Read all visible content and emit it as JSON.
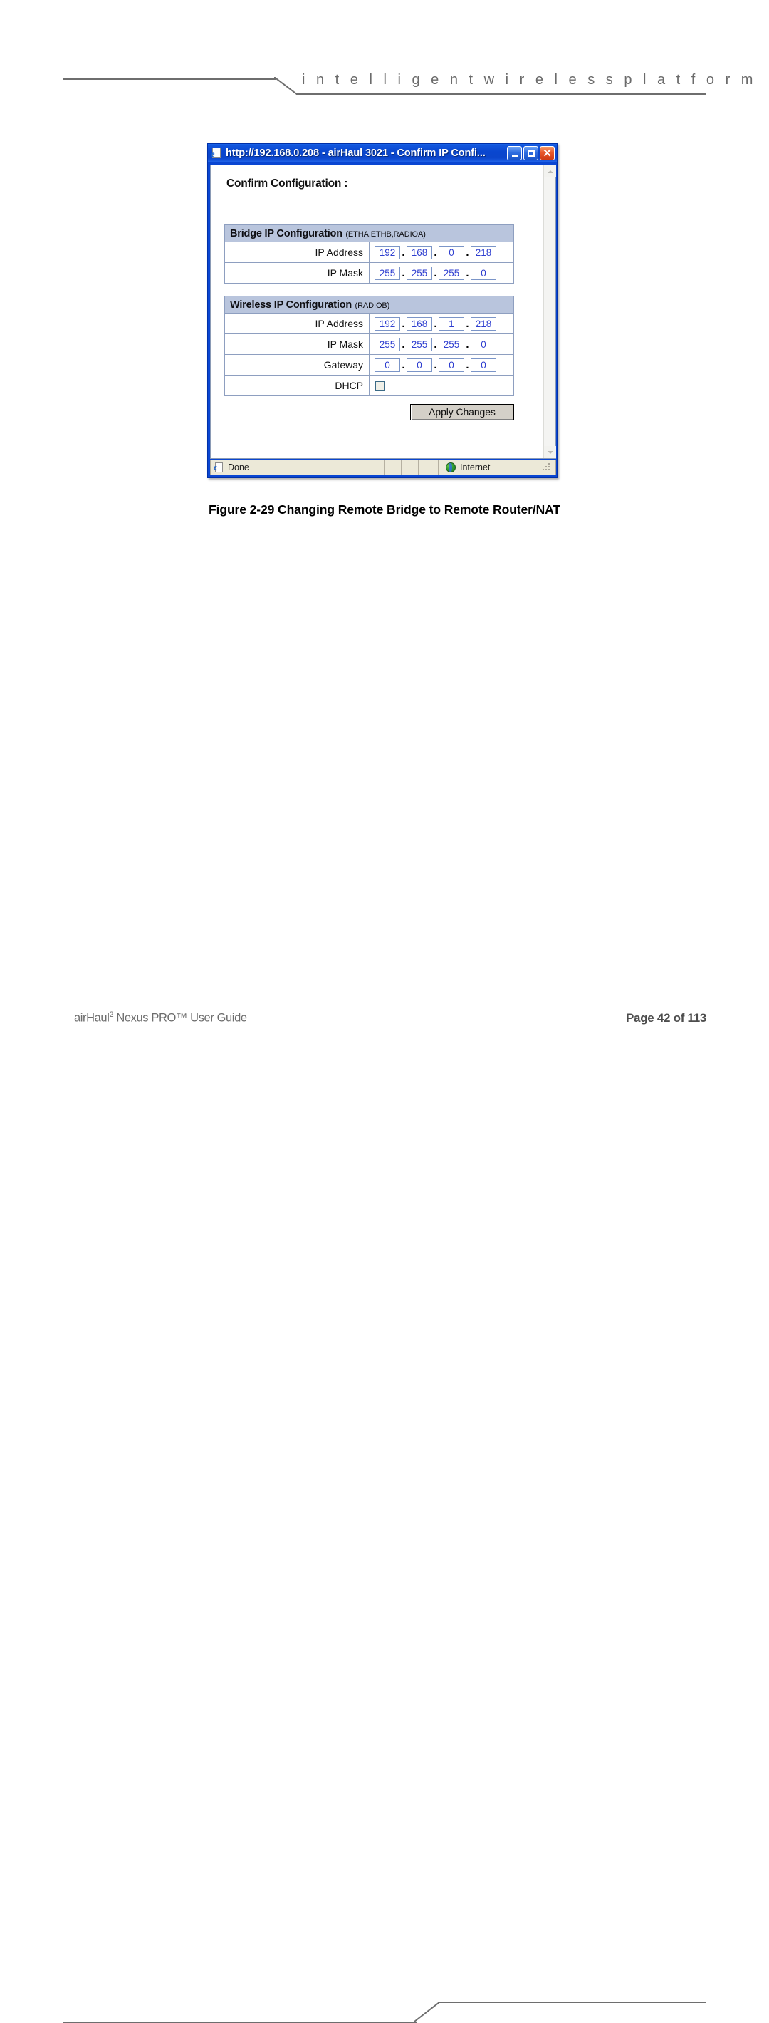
{
  "header": {
    "tagline": "i n t e l l i g e n t     w i r e l e s s     p l a t f o r m"
  },
  "browser": {
    "title": "http://192.168.0.208 - airHaul 3021 - Confirm IP Confi...",
    "window_buttons": {
      "minimize": "minimize",
      "maximize": "maximize",
      "close": "close"
    },
    "page": {
      "heading": "Confirm Configuration :",
      "sections": [
        {
          "title": "Bridge IP Configuration",
          "subtitle": "(ETHA,ETHB,RADIOA)",
          "rows": [
            {
              "label": "IP Address",
              "type": "ip",
              "octets": [
                "192",
                "168",
                "0",
                "218"
              ]
            },
            {
              "label": "IP Mask",
              "type": "ip",
              "octets": [
                "255",
                "255",
                "255",
                "0"
              ]
            }
          ]
        },
        {
          "title": "Wireless IP Configuration",
          "subtitle": "(RADIOB)",
          "rows": [
            {
              "label": "IP Address",
              "type": "ip",
              "octets": [
                "192",
                "168",
                "1",
                "218"
              ]
            },
            {
              "label": "IP Mask",
              "type": "ip",
              "octets": [
                "255",
                "255",
                "255",
                "0"
              ]
            },
            {
              "label": "Gateway",
              "type": "ip",
              "octets": [
                "0",
                "0",
                "0",
                "0"
              ]
            },
            {
              "label": "DHCP",
              "type": "checkbox",
              "checked": false
            }
          ]
        }
      ],
      "apply_button": "Apply Changes"
    },
    "statusbar": {
      "status": "Done",
      "zone": "Internet"
    }
  },
  "figure": {
    "caption": "Figure 2-29 Changing Remote Bridge to Remote Router/NAT"
  },
  "footer": {
    "left_main": "airHaul",
    "left_sup": "2",
    "left_rest": " Nexus PRO™ User Guide",
    "page_label": "Page 42 of 113"
  },
  "colors": {
    "titlebar_blue": "#0a46d2",
    "section_header": "#b9c5dd",
    "input_text": "#2f3fd0",
    "statusbar": "#ece9d8",
    "rule_gray": "#6e6e6e"
  }
}
